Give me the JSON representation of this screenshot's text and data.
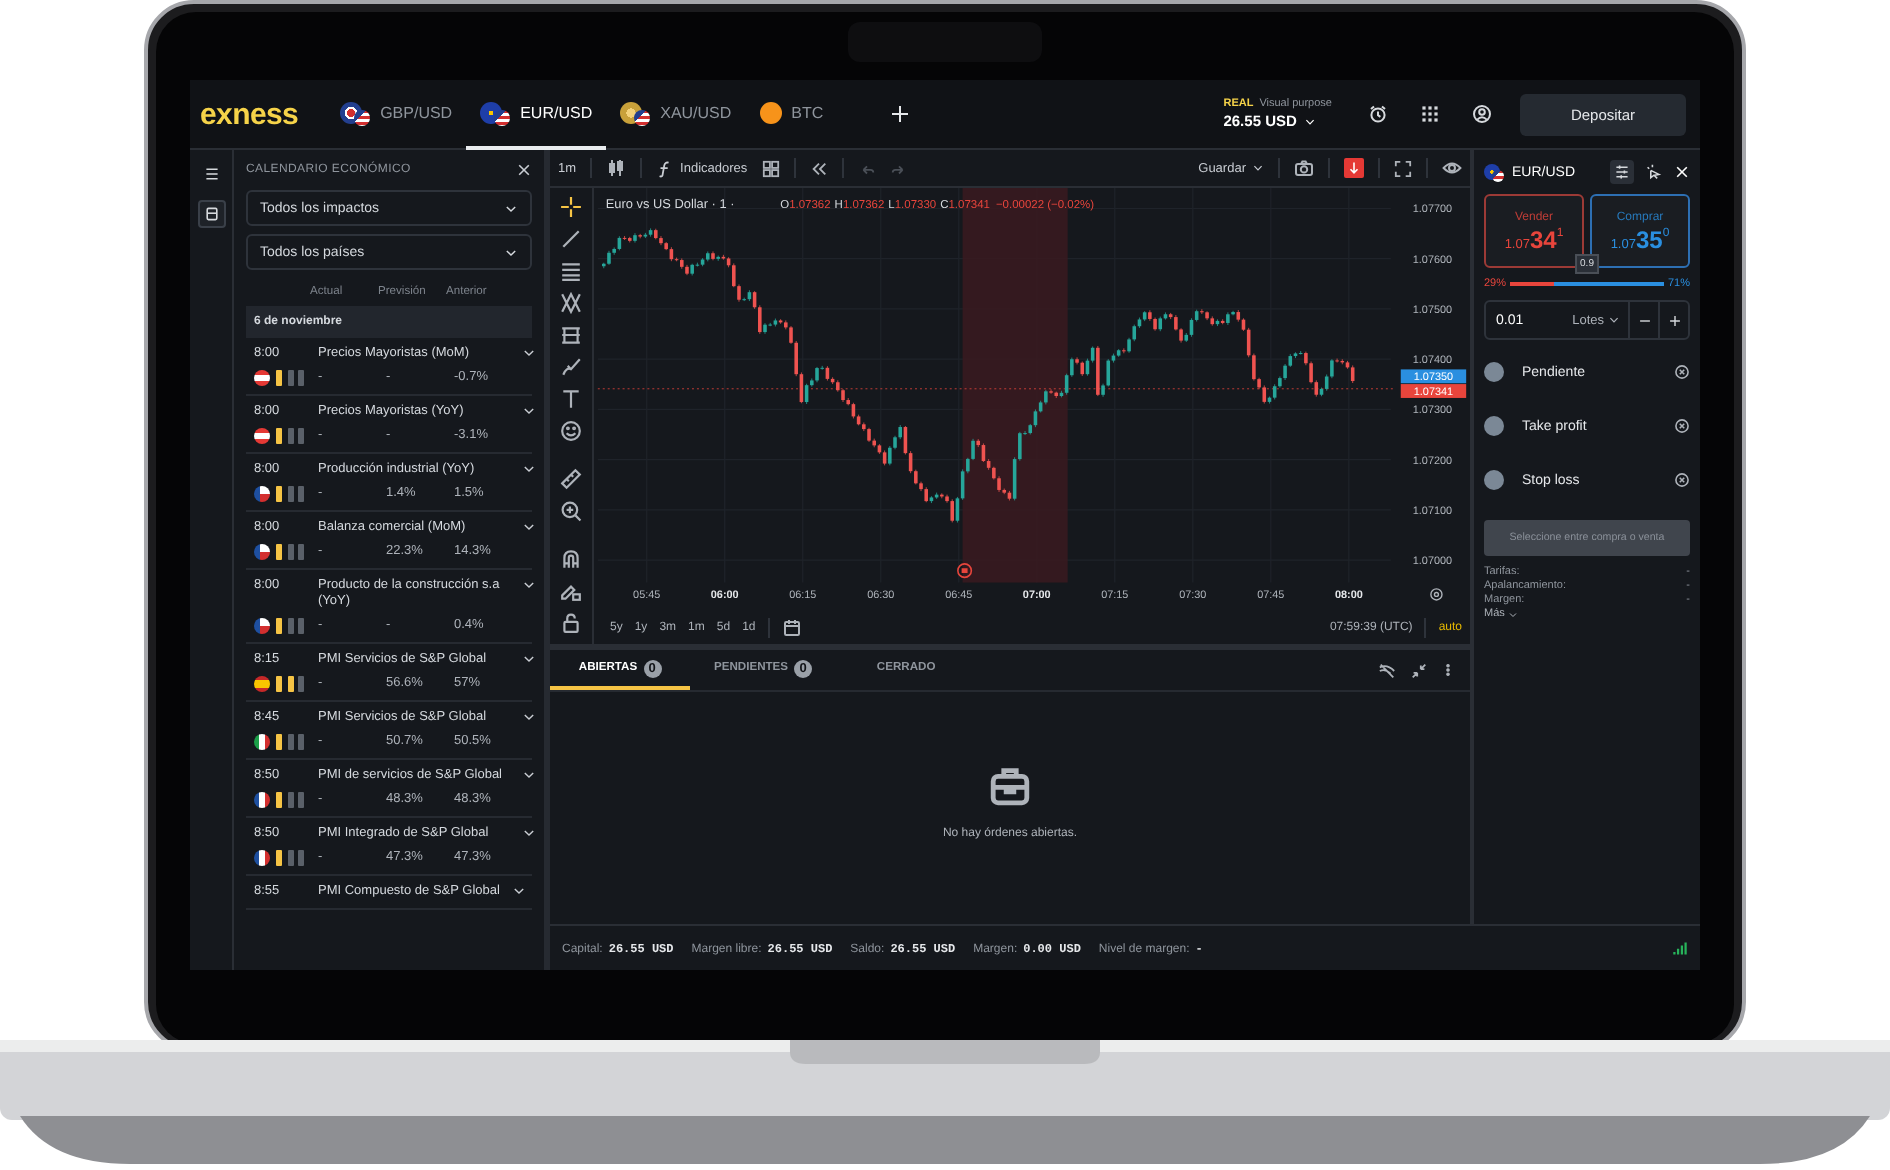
{
  "header": {
    "logo": "exness",
    "tabs": [
      {
        "label": "GBP/USD",
        "kind": "gbp",
        "selected": false
      },
      {
        "label": "EUR/USD",
        "kind": "eur",
        "selected": true
      },
      {
        "label": "XAU/USD",
        "kind": "xau",
        "selected": false
      },
      {
        "label": "BTC",
        "kind": "btc",
        "selected": false
      }
    ],
    "account": {
      "type": "REAL",
      "mode": "Visual purpose",
      "balance": "26.55 USD"
    },
    "deposit_button": "Depositar"
  },
  "calendar": {
    "title": "CALENDARIO ECONÓMICO",
    "filters": [
      "Todos los impactos",
      "Todos los países"
    ],
    "columns": [
      "Actual",
      "Previsión",
      "Anterior"
    ],
    "date": "6 de noviembre",
    "events": [
      {
        "time": "8:00",
        "name": "Precios Mayoristas (MoM)",
        "kind": "austria",
        "medium_impact": false,
        "actual": "-",
        "forecast": "-",
        "previous": "-0.7%"
      },
      {
        "time": "8:00",
        "name": "Precios Mayoristas (YoY)",
        "kind": "austria",
        "medium_impact": false,
        "actual": "-",
        "forecast": "-",
        "previous": "-3.1%"
      },
      {
        "time": "8:00",
        "name": "Producción industrial (YoY)",
        "kind": "czech",
        "medium_impact": false,
        "actual": "-",
        "forecast": "1.4%",
        "previous": "1.5%"
      },
      {
        "time": "8:00",
        "name": "Balanza comercial (MoM)",
        "kind": "czech",
        "medium_impact": false,
        "actual": "-",
        "forecast": "22.3%",
        "previous": "14.3%"
      },
      {
        "time": "8:00",
        "name": "Producto de la construcción s.a (YoY)",
        "kind": "czech",
        "medium_impact": false,
        "actual": "-",
        "forecast": "-",
        "previous": "0.4%"
      },
      {
        "time": "8:15",
        "name": "PMI Servicios de S&P Global",
        "kind": "spain",
        "medium_impact": true,
        "actual": "-",
        "forecast": "56.6%",
        "previous": "57%"
      },
      {
        "time": "8:45",
        "name": "PMI Servicios de S&P Global",
        "kind": "italy",
        "medium_impact": false,
        "actual": "-",
        "forecast": "50.7%",
        "previous": "50.5%"
      },
      {
        "time": "8:50",
        "name": "PMI de servicios de S&P Global",
        "kind": "france",
        "medium_impact": false,
        "actual": "-",
        "forecast": "48.3%",
        "previous": "48.3%"
      },
      {
        "time": "8:50",
        "name": "PMI Integrado de S&P Global",
        "kind": "france",
        "medium_impact": false,
        "actual": "-",
        "forecast": "47.3%",
        "previous": "47.3%"
      },
      {
        "time": "8:55",
        "name": "PMI Compuesto de S&P Global"
      }
    ]
  },
  "chart": {
    "toolbar": {
      "interval": "1m",
      "indicators": "Indicadores",
      "save": "Guardar"
    },
    "title": "Euro vs US Dollar · 1 ·",
    "ohlc": [
      {
        "label": "O",
        "value": "1.07362"
      },
      {
        "label": "H",
        "value": "1.07362"
      },
      {
        "label": "L",
        "value": "1.07330"
      },
      {
        "label": "C",
        "value": "1.07341"
      }
    ],
    "change": "−0.00022 (−0.02%)",
    "price_axis": [
      "1.07700",
      "1.07600",
      "1.07500",
      "1.07400",
      "1.07300",
      "1.07200",
      "1.07100",
      "1.07000"
    ],
    "price_tags": [
      {
        "value": "1.07350",
        "color": "#2a8fe0"
      },
      {
        "value": "1.07341",
        "color": "#e8453c"
      }
    ],
    "time_axis": [
      {
        "label": "05:45",
        "major": false
      },
      {
        "label": "06:00",
        "major": true
      },
      {
        "label": "06:15",
        "major": false
      },
      {
        "label": "06:30",
        "major": false
      },
      {
        "label": "06:45",
        "major": false
      },
      {
        "label": "07:00",
        "major": true
      },
      {
        "label": "07:15",
        "major": false
      },
      {
        "label": "07:30",
        "major": false
      },
      {
        "label": "07:45",
        "major": false
      },
      {
        "label": "08:00",
        "major": true
      }
    ],
    "ranges": [
      "5y",
      "1y",
      "3m",
      "1m",
      "5d",
      "1d"
    ],
    "clock": "07:59:39 (UTC)",
    "scale_mode": "auto"
  },
  "orders": {
    "tabs": [
      {
        "label": "ABIERTAS",
        "count": "0",
        "selected": true
      },
      {
        "label": "PENDIENTES",
        "count": "0",
        "selected": false
      },
      {
        "label": "CERRADO",
        "selected": false
      }
    ],
    "empty_message": "No hay órdenes abiertas."
  },
  "order_panel": {
    "symbol": "EUR/USD",
    "sell": {
      "label": "Vender",
      "price_main": "1.07",
      "price_big": "34",
      "price_sup": "1"
    },
    "buy": {
      "label": "Comprar",
      "price_main": "1.07",
      "price_big": "35",
      "price_sup": "0"
    },
    "spread": "0.9",
    "sentiment": {
      "sell": "29%",
      "buy": "71%",
      "level": 0.29
    },
    "volume": {
      "value": "0.01",
      "unit": "Lotes"
    },
    "options": [
      {
        "label": "Pendiente",
        "on": false
      },
      {
        "label": "Take profit",
        "on": false
      },
      {
        "label": "Stop loss",
        "on": false
      }
    ],
    "submit_button": {
      "label": "Seleccione entre compra o venta",
      "disabled": true
    },
    "details": [
      {
        "label": "Tarifas:",
        "value": "-"
      },
      {
        "label": "Apalancamiento:",
        "value": "-"
      },
      {
        "label": "Margen:",
        "value": "-"
      }
    ],
    "more": "Más"
  },
  "status_bar": {
    "items": [
      {
        "label": "Capital:",
        "value": "26.55 USD"
      },
      {
        "label": "Margen libre:",
        "value": "26.55 USD"
      },
      {
        "label": "Saldo:",
        "value": "26.55 USD"
      },
      {
        "label": "Margen:",
        "value": "0.00 USD"
      },
      {
        "label": "Nivel de margen:",
        "value": "-"
      }
    ]
  }
}
